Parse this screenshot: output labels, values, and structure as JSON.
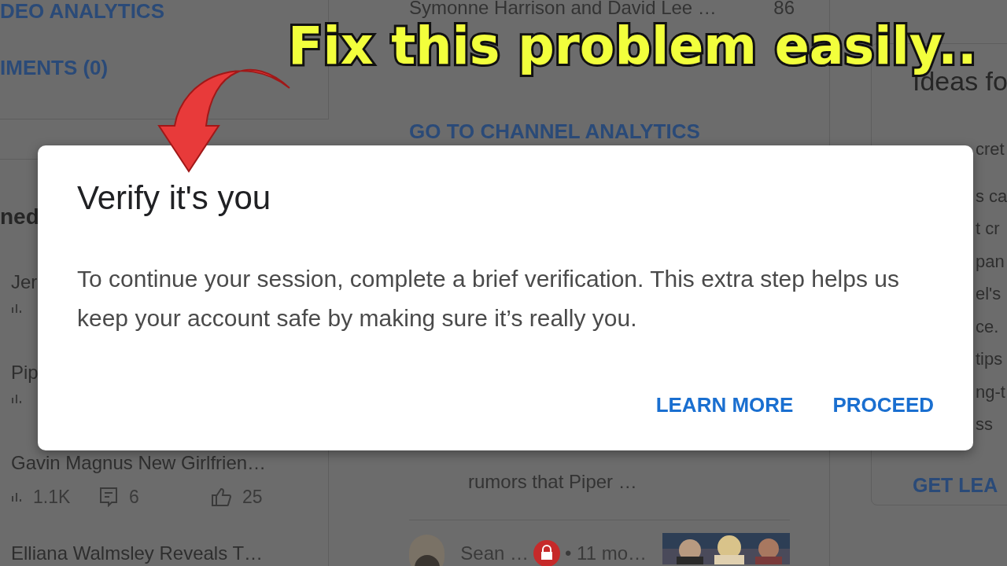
{
  "caption": "Fix this problem easily..",
  "left_column": {
    "links": [
      "DEO ANALYTICS",
      "IMENTS (0)"
    ],
    "heading": "ned",
    "videos": [
      {
        "kind": "cut",
        "title": "Jer"
      },
      {
        "kind": "cut",
        "title": "Pip"
      },
      {
        "kind": "full",
        "title": "Gavin Magnus New Girlfrien…",
        "views": "1.1K",
        "comments": "6",
        "likes": "25"
      },
      {
        "kind": "title_only",
        "title": "Elliana Walmsley Reveals T…"
      }
    ]
  },
  "middle_column": {
    "top_row": {
      "title": "Symonne Harrison and David Lee …",
      "value": "86"
    },
    "link": "GO TO CHANNEL ANALYTICS",
    "comment_text": "rumors that Piper …",
    "comment": {
      "author": "Sean …",
      "time": "• 11 mo…"
    }
  },
  "right_column": {
    "heading": "Ideas fo",
    "fragments": [
      "cret",
      "s ca",
      "t cr",
      "pan",
      "el's",
      "ce.",
      "tips",
      "ng-t",
      "ss"
    ],
    "link": "GET LEA"
  },
  "dialog": {
    "title": "Verify it's you",
    "body": "To continue your session, complete a brief verification. This extra step helps us keep your account safe by making sure it’s really you.",
    "buttons": [
      "LEARN MORE",
      "PROCEED"
    ]
  }
}
